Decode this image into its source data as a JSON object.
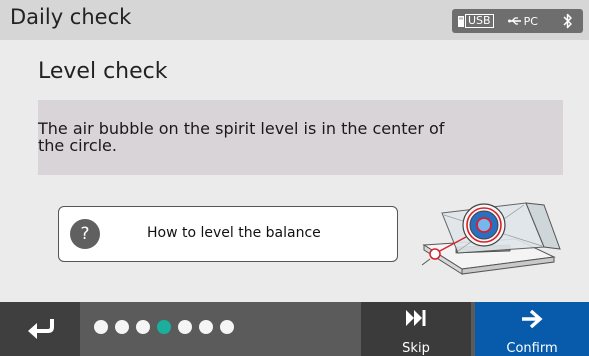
{
  "header": {
    "title": "Daily check",
    "status": {
      "usb_label": "USB",
      "pc_label": "PC",
      "bluetooth_icon": "bluetooth-icon"
    }
  },
  "main": {
    "heading": "Level check",
    "instruction": "The air bubble on the spirit level is in the center of the circle.",
    "help": {
      "icon": "?",
      "label": "How to level the balance"
    }
  },
  "footer": {
    "progress": {
      "total_steps": 7,
      "current_step": 4
    },
    "skip_label": "Skip",
    "confirm_label": "Confirm"
  },
  "colors": {
    "accent_confirm": "#085aab",
    "progress_active": "#1ab09d",
    "spirit_level_circle": "#d9202a",
    "bubble": "#3b7cc9"
  }
}
